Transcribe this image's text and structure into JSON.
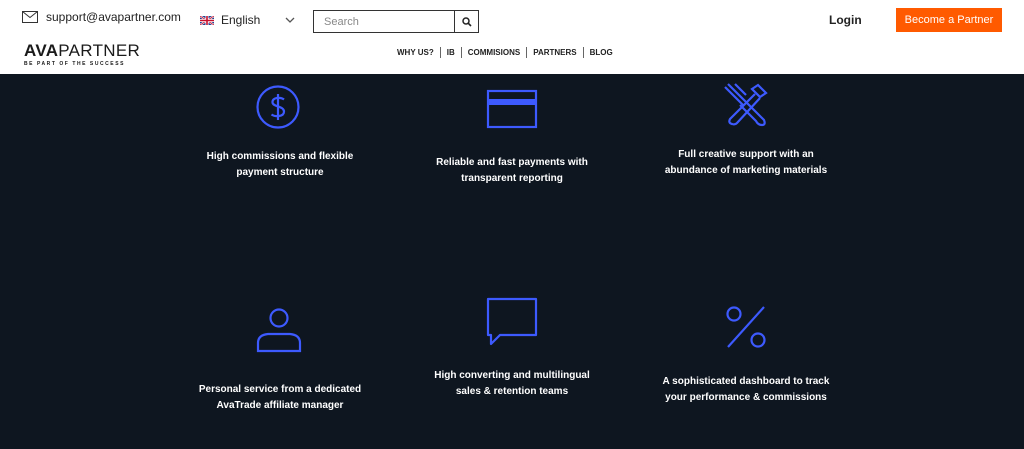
{
  "topbar": {
    "email": "support@avapartner.com",
    "language": "English",
    "search_placeholder": "Search",
    "login_label": "Login",
    "cta_label": "Become a Partner"
  },
  "logo": {
    "name_bold": "AVA",
    "name_light": "PARTNER",
    "tagline": "BE PART OF THE SUCCESS"
  },
  "nav": {
    "items": [
      "WHY US?",
      "IB",
      "COMMISIONS",
      "PARTNERS",
      "BLOG"
    ]
  },
  "features": [
    {
      "icon": "dollar-icon",
      "text": "High commissions and flexible payment structure"
    },
    {
      "icon": "credit-card-icon",
      "text": "Reliable and fast payments with transparent reporting"
    },
    {
      "icon": "tools-icon",
      "text": "Full creative support with an abundance of marketing materials"
    },
    {
      "icon": "person-icon",
      "text": "Personal service from a dedicated AvaTrade affiliate manager"
    },
    {
      "icon": "chat-icon",
      "text": "High converting and multilingual sales & retention teams"
    },
    {
      "icon": "percent-icon",
      "text": "A sophisticated dashboard to track your performance & commissions"
    }
  ],
  "colors": {
    "accent": "#ff5a00",
    "icon": "#3d5afe",
    "background": "#0e1620"
  }
}
